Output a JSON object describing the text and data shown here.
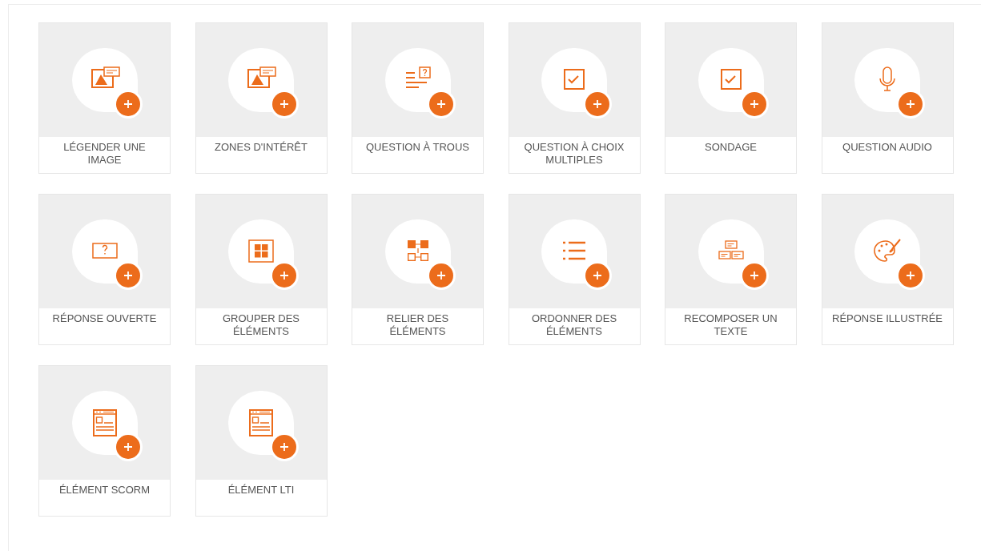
{
  "exercise_types": [
    {
      "label": "LÉGENDER UNE IMAGE",
      "kind": "image-caption"
    },
    {
      "label": "ZONES D'INTÉRÊT",
      "kind": "image-caption"
    },
    {
      "label": "QUESTION À TROUS",
      "kind": "cloze"
    },
    {
      "label": "QUESTION À CHOIX MULTIPLES",
      "kind": "checkbox"
    },
    {
      "label": "SONDAGE",
      "kind": "checkbox"
    },
    {
      "label": "QUESTION AUDIO",
      "kind": "microphone"
    },
    {
      "label": "RÉPONSE OUVERTE",
      "kind": "question-box"
    },
    {
      "label": "GROUPER DES ÉLÉMENTS",
      "kind": "grid"
    },
    {
      "label": "RELIER DES ÉLÉMENTS",
      "kind": "connect"
    },
    {
      "label": "ORDONNER DES ÉLÉMENTS",
      "kind": "list"
    },
    {
      "label": "RECOMPOSER UN TEXTE",
      "kind": "blocks"
    },
    {
      "label": "RÉPONSE ILLUSTRÉE",
      "kind": "palette"
    },
    {
      "label": "ÉLÉMENT SCORM",
      "kind": "webpage"
    },
    {
      "label": "ÉLÉMENT LTI",
      "kind": "webpage"
    }
  ]
}
